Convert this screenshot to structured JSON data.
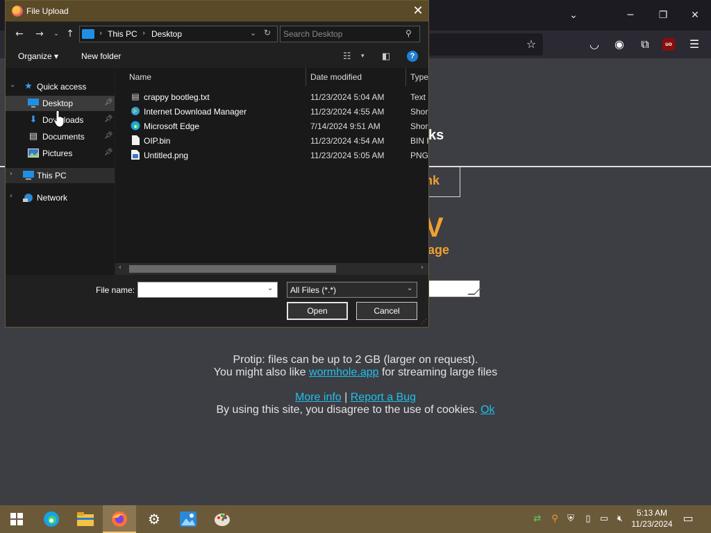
{
  "browser": {
    "toolbar_icons": [
      "star-icon",
      "pocket-icon",
      "account-icon",
      "extensions-icon",
      "menu-icon"
    ],
    "ublock_label": "uo"
  },
  "page": {
    "heading_fragment": "ks",
    "link_fragment": "nk",
    "big_fragment": "V",
    "sub_fragment": "age",
    "protip_line1": "Protip: files can be up to 2 GB (larger on request).",
    "protip_line2_pre": "You might also like ",
    "protip_line2_link": "wormhole.app",
    "protip_line2_post": " for streaming large files",
    "more_info": "More info",
    "separator": " | ",
    "report_bug": "Report a Bug",
    "cookie_text": "By using this site, you disagree to the use of cookies. ",
    "cookie_ok": "Ok",
    "link_color": "#20c0e8",
    "accent_color": "#f0a030"
  },
  "dialog": {
    "title": "File Upload",
    "breadcrumb": [
      "This PC",
      "Desktop"
    ],
    "search_placeholder": "Search Desktop",
    "organize_label": "Organize ▾",
    "new_folder_label": "New folder",
    "nav": [
      {
        "label": "Quick access",
        "icon": "star-icon"
      },
      {
        "label": "Desktop",
        "icon": "desktop-icon",
        "pinned": true,
        "selected": true
      },
      {
        "label": "Downloads",
        "icon": "download-icon",
        "pinned": true
      },
      {
        "label": "Documents",
        "icon": "documents-icon",
        "pinned": true
      },
      {
        "label": "Pictures",
        "icon": "pictures-icon",
        "pinned": true
      },
      {
        "label": "This PC",
        "icon": "computer-icon"
      },
      {
        "label": "Network",
        "icon": "network-icon"
      }
    ],
    "columns": [
      "Name",
      "Date modified",
      "Type"
    ],
    "files": [
      {
        "name": "crappy bootleg.txt",
        "date": "11/23/2024 5:04 AM",
        "type": "Text D",
        "icon": "text-file-icon"
      },
      {
        "name": "Internet Download Manager",
        "date": "11/23/2024 4:55 AM",
        "type": "Short",
        "icon": "idm-shortcut-icon"
      },
      {
        "name": "Microsoft Edge",
        "date": "7/14/2024 9:51 AM",
        "type": "Short",
        "icon": "edge-shortcut-icon"
      },
      {
        "name": "OIP.bin",
        "date": "11/23/2024 4:54 AM",
        "type": "BIN F",
        "icon": "bin-file-icon"
      },
      {
        "name": "Untitled.png",
        "date": "11/23/2024 5:05 AM",
        "type": "PNG",
        "icon": "image-file-icon"
      }
    ],
    "file_name_label": "File name:",
    "file_name_value": "",
    "filter_value": "All Files (*.*)",
    "open_label": "Open",
    "cancel_label": "Cancel"
  },
  "taskbar": {
    "apps": [
      "windows-start-icon",
      "edge-icon",
      "file-explorer-icon",
      "firefox-icon",
      "settings-icon",
      "photos-icon",
      "paint-icon"
    ],
    "active_app": "firefox-icon",
    "tray": [
      "network-status-icon",
      "search-tray-icon",
      "defender-icon",
      "usb-icon",
      "network-icon",
      "volume-muted-icon"
    ],
    "time": "5:13 AM",
    "date": "11/23/2024",
    "notification_icon": "notification-icon"
  }
}
